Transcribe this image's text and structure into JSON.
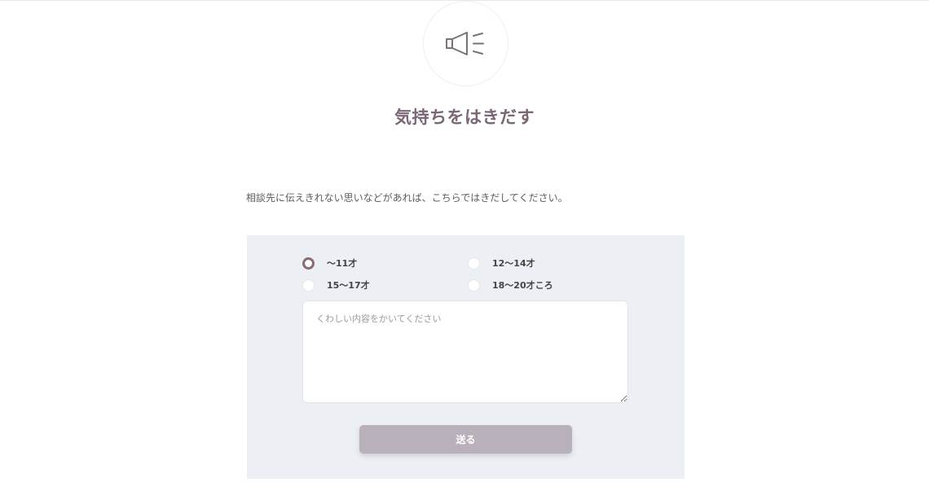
{
  "header": {
    "icon": "megaphone-icon",
    "title": "気持ちをはきだす"
  },
  "description": "相談先に伝えきれない思いなどがあれば、こちらではきだしてください。",
  "form": {
    "age_options": [
      {
        "label": "〜11才",
        "selected": true
      },
      {
        "label": "12〜14才",
        "selected": false
      },
      {
        "label": "15〜17才",
        "selected": false
      },
      {
        "label": "18〜20才ころ",
        "selected": false
      }
    ],
    "textarea": {
      "value": "",
      "placeholder": "くわしい内容をかいてください"
    },
    "submit_label": "送る"
  },
  "colors": {
    "accent": "#7a6674",
    "panel_bg": "#ecf0f4",
    "button_bg": "#b8b0ba",
    "radio_selected": "#8c6a72"
  }
}
